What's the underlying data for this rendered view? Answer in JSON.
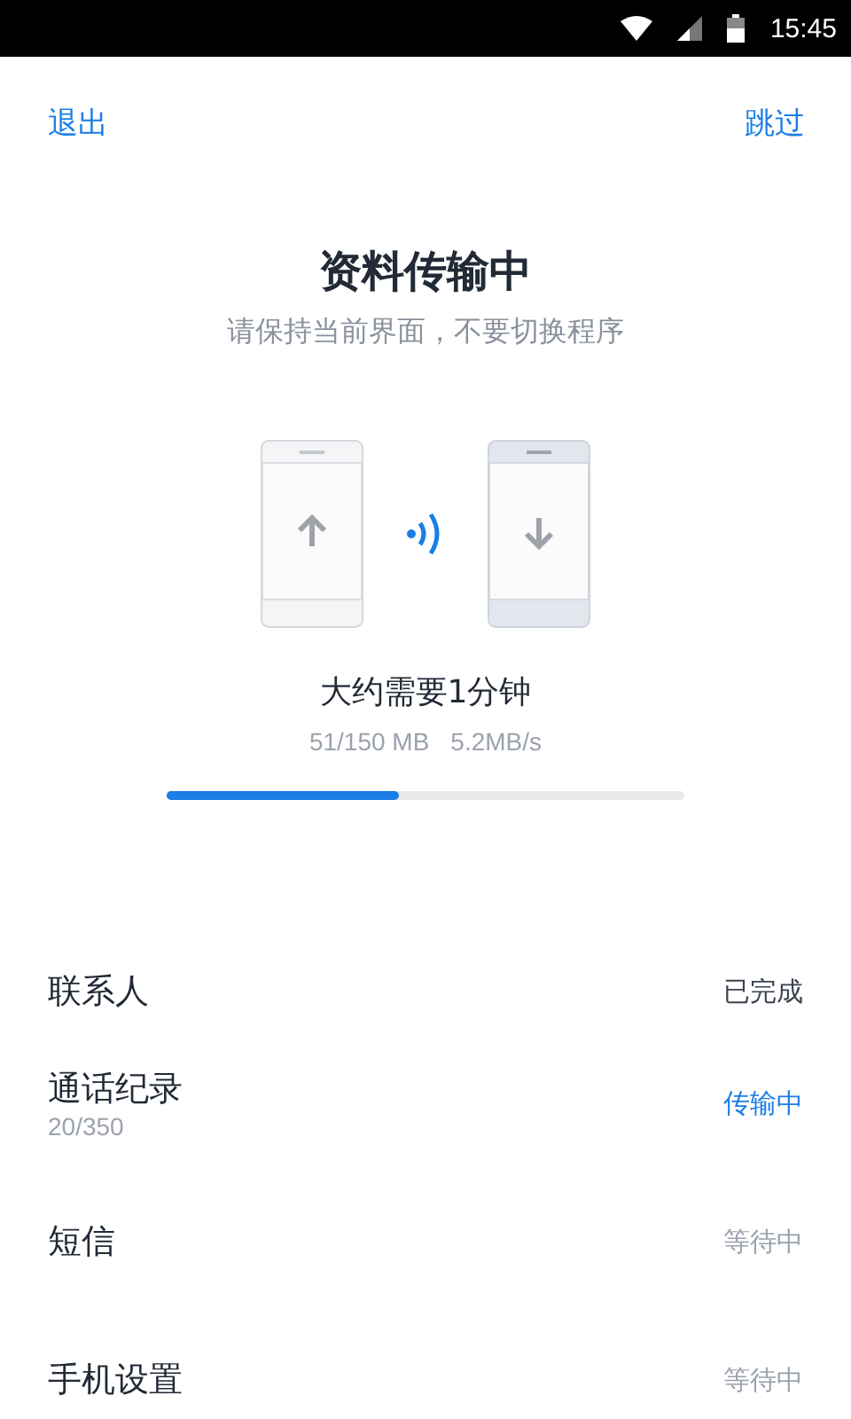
{
  "status_bar": {
    "time": "15:45"
  },
  "header": {
    "left": "退出",
    "right": "跳过"
  },
  "title": "资料传输中",
  "subtitle": "请保持当前界面，不要切换程序",
  "transfer": {
    "estimate": "大约需要1分钟",
    "size": "51/150 MB",
    "speed": "5.2MB/s",
    "level": 0.45
  },
  "items": [
    {
      "name": "联系人",
      "status": "已完成",
      "kind": "done"
    },
    {
      "name": "通话纪录",
      "detail": "20/350",
      "status": "传输中",
      "kind": "active"
    },
    {
      "name": "短信",
      "status": "等待中",
      "kind": "waiting"
    },
    {
      "name": "手机设置",
      "status": "等待中",
      "kind": "waiting"
    }
  ]
}
